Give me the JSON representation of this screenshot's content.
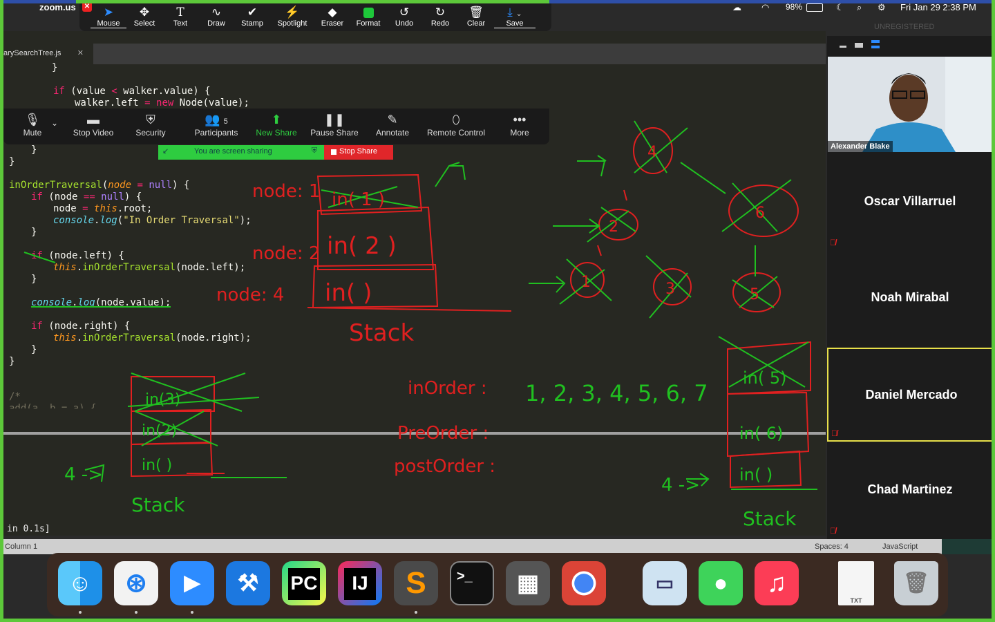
{
  "menubar": {
    "app_name": "zoom.us",
    "battery": "98%",
    "datetime": "Fri Jan 29  2:38 PM"
  },
  "annotate_toolbar": {
    "tools": [
      {
        "icon": "cursor-arrow-icon",
        "label": "Mouse"
      },
      {
        "icon": "move-icon",
        "label": "Select"
      },
      {
        "icon": "text-icon",
        "label": "Text"
      },
      {
        "icon": "squiggle-icon",
        "label": "Draw"
      },
      {
        "icon": "checkmark-icon",
        "label": "Stamp"
      },
      {
        "icon": "wand-icon",
        "label": "Spotlight"
      },
      {
        "icon": "eraser-icon",
        "label": "Eraser"
      },
      {
        "icon": "color-square-icon",
        "label": "Format"
      },
      {
        "icon": "undo-icon",
        "label": "Undo"
      },
      {
        "icon": "redo-icon",
        "label": "Redo"
      },
      {
        "icon": "trash-icon",
        "label": "Clear"
      },
      {
        "icon": "save-icon",
        "label": "Save"
      }
    ]
  },
  "editor": {
    "tab_name": "arySearchTree.js",
    "status_left": "Column 1",
    "status_spaces": "Spaces: 4",
    "status_lang": "JavaScript",
    "unregistered": "UNREGISTERED",
    "terminal_text": "in 0.1s]"
  },
  "code_lines": [
    "        }",
    "        if (value < walker.value) {",
    "            walker.left = new Node(value);",
    "    }",
    "}",
    "inOrderTraversal(node = null) {",
    "    if (node == null) {",
    "        node = this.root;",
    "        console.log(\"In Order Traversal\");",
    "    }",
    "    if (node.left) {",
    "        this.inOrderTraversal(node.left);",
    "    }",
    "    console.log(node.value);",
    "    if (node.right) {",
    "        this.inOrderTraversal(node.right);",
    "    }",
    "}",
    "/*",
    "add(a, b = a) {"
  ],
  "meeting_controls": {
    "mute": "Mute",
    "stop_video": "Stop Video",
    "security": "Security",
    "participants": "Participants",
    "participant_count": "5",
    "new_share": "New Share",
    "pause_share": "Pause Share",
    "annotate": "Annotate",
    "remote_control": "Remote Control",
    "more": "More",
    "sharing_banner": "You are screen sharing",
    "stop_share": "Stop Share"
  },
  "participants": [
    {
      "name": "Alexander Blake",
      "video": true
    },
    {
      "name": "Oscar Villarruel",
      "muted": true
    },
    {
      "name": "Noah Mirabal",
      "muted": false
    },
    {
      "name": "Daniel Mercado",
      "muted": true,
      "active": true
    },
    {
      "name": "Chad Martinez",
      "muted": true
    }
  ],
  "annotations": {
    "node1": "node: 1",
    "node2": "node: 2",
    "node4": "node: 4",
    "in1": "in( 1 )",
    "in2": "in( 2 )",
    "in_empty": "in( )",
    "stack": "Stack",
    "inorder": "inOrder :",
    "inorder_seq": "1, 2, 3, 4, 5, 6, 7",
    "preorder": "PreOrder :",
    "postorder": "postOrder :",
    "left_stack_3": "in(3)",
    "left_stack_2": "in(2)",
    "left_stack_1": "in( )",
    "left_label": "4 ->",
    "right_stack_5": "in( 5)",
    "right_stack_6": "in( 6)",
    "right_stack_0": "in( )",
    "right_label": "4 ->",
    "tree_nodes": [
      "4",
      "2",
      "6",
      "1",
      "3",
      "5"
    ]
  },
  "dock": [
    {
      "icon": "finder-icon",
      "label": ""
    },
    {
      "icon": "safari-icon",
      "label": ""
    },
    {
      "icon": "zoom-icon",
      "label": ""
    },
    {
      "icon": "xcode-icon",
      "label": ""
    },
    {
      "icon": "pycharm-icon",
      "label": "PC"
    },
    {
      "icon": "intellij-icon",
      "label": "IJ"
    },
    {
      "icon": "sublime-icon",
      "label": "S"
    },
    {
      "icon": "terminal-icon",
      "label": ">_"
    },
    {
      "icon": "calculator-icon",
      "label": ""
    },
    {
      "icon": "chrome-icon",
      "label": ""
    },
    {
      "icon": "preview-icon",
      "label": ""
    },
    {
      "icon": "messages-icon",
      "label": ""
    },
    {
      "icon": "music-icon",
      "label": ""
    },
    {
      "icon": "txt-file-icon",
      "label": "TXT"
    },
    {
      "icon": "trash-icon",
      "label": ""
    }
  ],
  "colors": {
    "frame": "#5dc83a",
    "menubar": "#2e4fa8",
    "editor_bg": "#272822",
    "annotation_red": "#e02020",
    "annotation_green": "#20c020"
  }
}
